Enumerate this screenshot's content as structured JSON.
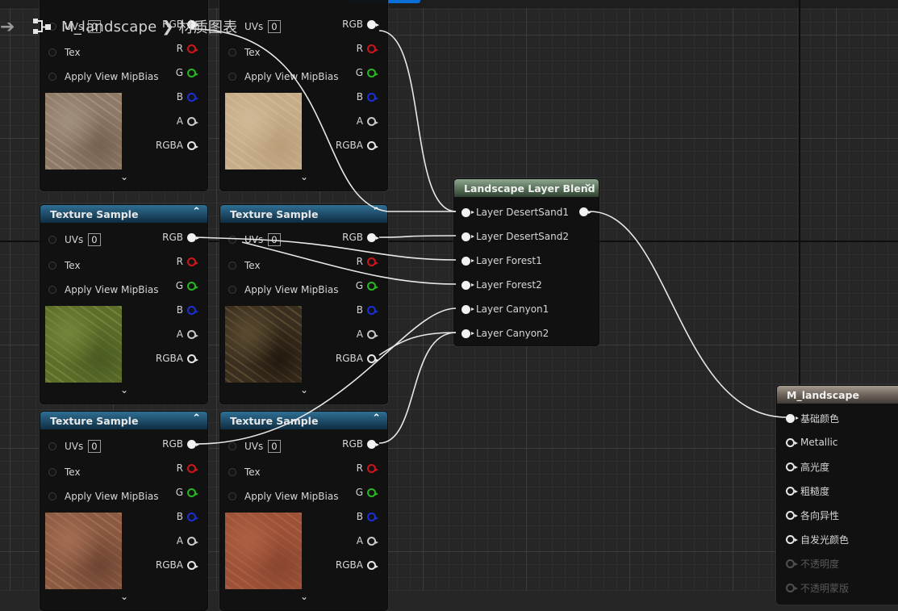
{
  "breadcrumb": {
    "graph": "M_landscape",
    "separator": "❯",
    "current": "材质图表"
  },
  "texture_node": {
    "title": "Texture Sample",
    "inputs": {
      "uvs": "UVs",
      "uv_value": "0",
      "tex": "Tex",
      "mip": "Apply View MipBias"
    },
    "outputs": {
      "rgb": "RGB",
      "r": "R",
      "g": "G",
      "b": "B",
      "a": "A",
      "rgba": "RGBA"
    },
    "expand_glyph": "⌄",
    "collapse_glyph": "⌃"
  },
  "texture_swatches": {
    "desert1": [
      "#8e7a66",
      "#a0907c",
      "#75624f"
    ],
    "desert2": [
      "#c6ac88",
      "#d0b896",
      "#b99e7a"
    ],
    "forest1": [
      "#5c6e2a",
      "#74843a",
      "#4a5a22"
    ],
    "forest2": [
      "#3a2f1f",
      "#5a4a30",
      "#22190f"
    ],
    "canyon1": [
      "#8a5a42",
      "#a26c52",
      "#6e4432"
    ],
    "canyon2": [
      "#9c5238",
      "#ad5f42",
      "#8a4630"
    ]
  },
  "blend_node": {
    "title": "Landscape Layer Blend",
    "collapse_glyph": "⌄",
    "layers": [
      "Layer DesertSand1",
      "Layer DesertSand2",
      "Layer Forest1",
      "Layer Forest2",
      "Layer Canyon1",
      "Layer Canyon2"
    ]
  },
  "material_node": {
    "title": "M_landscape",
    "inputs": [
      "基础颜色",
      "Metallic",
      "高光度",
      "粗糙度",
      "各向异性",
      "自发光颜色",
      "不透明度",
      "不透明蒙版"
    ]
  },
  "colors": {
    "texture_header": "#1d4a66",
    "blend_header": "#5b745c",
    "material_header": "#6f655c",
    "pin_r": "#d0141b",
    "pin_g": "#27b81e",
    "pin_b": "#1a2fd4",
    "tab_accent": "#0a6fd6"
  }
}
